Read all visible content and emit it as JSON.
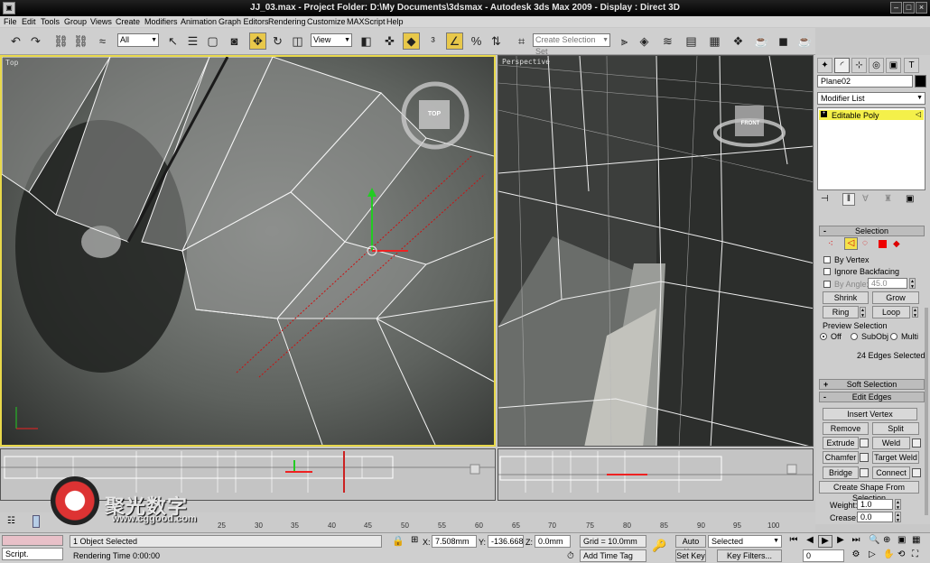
{
  "window": {
    "title": "JJ_03.max   - Project Folder: D:\\My Documents\\3dsmax     - Autodesk 3ds Max  2009     - Display : Direct 3D",
    "app_icon": "3ds-max-icon"
  },
  "menu": [
    "File",
    "Edit",
    "Tools",
    "Group",
    "Views",
    "Create",
    "Modifiers",
    "Animation",
    "Graph Editors",
    "Rendering",
    "Customize",
    "MAXScript",
    "Help"
  ],
  "toolbar": {
    "selection_filter": "All",
    "reference_coord": "View",
    "named_selection_placeholder": "Create Selection Set"
  },
  "viewports": {
    "top_label": "Top",
    "perspective_label": "Perspective",
    "viewcube_top": "TOP",
    "viewcube_front": "FRONT"
  },
  "command_panel": {
    "object_name": "Plane02",
    "modifier_list": "Modifier List",
    "stack_item": "Editable Poly",
    "selection": {
      "header": "Selection",
      "by_vertex": "By Vertex",
      "ignore_backfacing": "Ignore Backfacing",
      "by_angle": "By Angle:",
      "angle_value": "45.0",
      "shrink": "Shrink",
      "grow": "Grow",
      "ring": "Ring",
      "loop": "Loop",
      "preview_title": "Preview Selection",
      "preview_off": "Off",
      "preview_subobj": "SubObj",
      "preview_multi": "Multi",
      "status": "24 Edges Selected"
    },
    "soft_selection": "Soft Selection",
    "edit_edges": {
      "header": "Edit Edges",
      "insert_vertex": "Insert Vertex",
      "remove": "Remove",
      "split": "Split",
      "extrude": "Extrude",
      "weld": "Weld",
      "chamfer": "Chamfer",
      "target_weld": "Target Weld",
      "bridge": "Bridge",
      "connect": "Connect",
      "create_shape": "Create Shape From Selection",
      "weight_label": "Weight:",
      "weight_value": "1.0",
      "crease_label": "Crease:",
      "crease_value": "0.0"
    }
  },
  "timeline": {
    "ticks": [
      "25",
      "30",
      "35",
      "40",
      "45",
      "50",
      "55",
      "60",
      "65",
      "70",
      "75",
      "80",
      "85",
      "90",
      "95",
      "100"
    ]
  },
  "status": {
    "script_label": "Script.",
    "selected": "1 Object Selected",
    "prompt": "Rendering Time  0:00:00",
    "x_label": "X:",
    "x_value": "7.508mm",
    "y_label": "Y:",
    "y_value": "-136.668mm",
    "z_label": "Z:",
    "z_value": "0.0mm",
    "grid": "Grid = 10.0mm",
    "add_time_tag": "Add Time Tag",
    "auto_key": "Auto Key",
    "set_key": "Set Key",
    "selected_dd": "Selected",
    "key_filters": "Key Filters...",
    "frame": "0"
  },
  "watermark": {
    "cn": "聚光数字",
    "url": "www.cggood.com"
  },
  "colors": {
    "active_viewport_border": "#e8d84a",
    "stack_highlight": "#f4f04a",
    "title_bg": "#000000"
  }
}
